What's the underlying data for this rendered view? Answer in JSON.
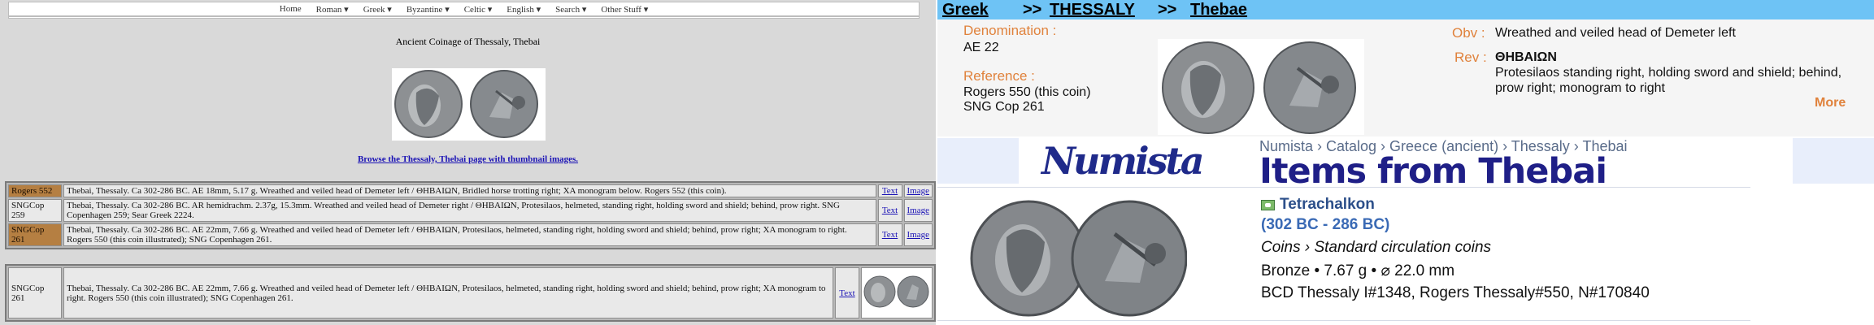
{
  "left": {
    "nav": [
      "Home",
      "Roman ▾",
      "Greek ▾",
      "Byzantine ▾",
      "Celtic ▾",
      "English ▾",
      "Search ▾",
      "Other Stuff ▾"
    ],
    "page_title": "Ancient Coinage of Thessaly, Thebai",
    "browse_link": "Browse the Thessaly, Thebai page with thumbnail images.",
    "rows": [
      {
        "ref": "Rogers 552",
        "highlight": true,
        "desc": "Thebai, Thessaly. Ca 302-286 BC. AE 18mm, 5.17 g. Wreathed and veiled head of Demeter left / ΘΗΒΑΙΩΝ, Bridled horse trotting right; XA monogram below. Rogers 552 (this coin).",
        "text": "Text",
        "image": "Image"
      },
      {
        "ref": "SNGCop 259",
        "highlight": false,
        "desc": "Thebai, Thessaly. Ca 302-286 BC. AR hemidrachm. 2.37g, 15.3mm. Wreathed and veiled head of Demeter right / ΘΗΒΑΙΩΝ, Protesilaos, helmeted, standing right, holding sword and shield; behind, prow right. SNG Copenhagen 259; Sear Greek 2224.",
        "text": "Text",
        "image": "Image"
      },
      {
        "ref": "SNGCop 261",
        "highlight": true,
        "desc": "Thebai, Thessaly. Ca 302-286 BC. AE 22mm, 7.66 g. Wreathed and veiled head of Demeter left / ΘΗΒΑΙΩΝ, Protesilaos, helmeted, standing right, holding sword and shield; behind, prow right; XA monogram to right. Rogers 550 (this coin illustrated); SNG Copenhagen 261.",
        "text": "Text",
        "image": "Image"
      }
    ],
    "detail": {
      "ref": "SNGCop 261",
      "desc": "Thebai, Thessaly. Ca 302-286 BC. AE 22mm, 7.66 g. Wreathed and veiled head of Demeter left / ΘΗΒΑΙΩΝ, Protesilaos, helmeted, standing right, holding sword and shield; behind, prow right; XA monogram to right. Rogers 550 (this coin illustrated); SNG Copenhagen 261.",
      "text": "Text"
    }
  },
  "right": {
    "crumb": {
      "greek": "Greek",
      "sep1": ">>",
      "thessaly": "THESSALY",
      "sep2": ">>",
      "thebae": "Thebae"
    },
    "denomination_label": "Denomination :",
    "denomination": "AE 22",
    "reference_label": "Reference :",
    "reference_lines": [
      "Rogers 550 (this coin)",
      "SNG Cop 261"
    ],
    "obv_label": "Obv :",
    "obv": "Wreathed and veiled head of Demeter left",
    "rev_label": "Rev :",
    "rev_legend": "ΘΗΒΑΙΩΝ",
    "rev_lines": [
      "Protesilaos standing right, holding sword and shield; behind,",
      "prow right; monogram to right"
    ],
    "more": "More",
    "numista": {
      "logo": "Numista",
      "breadcrumb": "Numista › Catalog › Greece (ancient) › Thessaly › Thebai",
      "title": "Items from Thebai"
    },
    "item": {
      "name": "Tetrachalkon",
      "dates": "(302 BC - 286 BC)",
      "category": "Coins › Standard circulation coins",
      "specs": "Bronze • 7.67 g • ⌀ 22.0 mm",
      "refs": "BCD Thessaly I#1348, Rogers Thessaly#550, N#170840"
    }
  }
}
